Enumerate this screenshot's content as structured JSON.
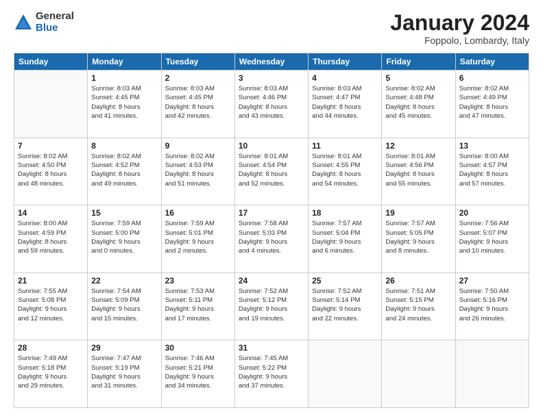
{
  "logo": {
    "general": "General",
    "blue": "Blue"
  },
  "header": {
    "month": "January 2024",
    "location": "Foppolo, Lombardy, Italy"
  },
  "days_of_week": [
    "Sunday",
    "Monday",
    "Tuesday",
    "Wednesday",
    "Thursday",
    "Friday",
    "Saturday"
  ],
  "weeks": [
    [
      {
        "day": "",
        "info": ""
      },
      {
        "day": "1",
        "info": "Sunrise: 8:03 AM\nSunset: 4:45 PM\nDaylight: 8 hours\nand 41 minutes."
      },
      {
        "day": "2",
        "info": "Sunrise: 8:03 AM\nSunset: 4:45 PM\nDaylight: 8 hours\nand 42 minutes."
      },
      {
        "day": "3",
        "info": "Sunrise: 8:03 AM\nSunset: 4:46 PM\nDaylight: 8 hours\nand 43 minutes."
      },
      {
        "day": "4",
        "info": "Sunrise: 8:03 AM\nSunset: 4:47 PM\nDaylight: 8 hours\nand 44 minutes."
      },
      {
        "day": "5",
        "info": "Sunrise: 8:02 AM\nSunset: 4:48 PM\nDaylight: 8 hours\nand 45 minutes."
      },
      {
        "day": "6",
        "info": "Sunrise: 8:02 AM\nSunset: 4:49 PM\nDaylight: 8 hours\nand 47 minutes."
      }
    ],
    [
      {
        "day": "7",
        "info": "Sunrise: 8:02 AM\nSunset: 4:50 PM\nDaylight: 8 hours\nand 48 minutes."
      },
      {
        "day": "8",
        "info": "Sunrise: 8:02 AM\nSunset: 4:52 PM\nDaylight: 8 hours\nand 49 minutes."
      },
      {
        "day": "9",
        "info": "Sunrise: 8:02 AM\nSunset: 4:53 PM\nDaylight: 8 hours\nand 51 minutes."
      },
      {
        "day": "10",
        "info": "Sunrise: 8:01 AM\nSunset: 4:54 PM\nDaylight: 8 hours\nand 52 minutes."
      },
      {
        "day": "11",
        "info": "Sunrise: 8:01 AM\nSunset: 4:55 PM\nDaylight: 8 hours\nand 54 minutes."
      },
      {
        "day": "12",
        "info": "Sunrise: 8:01 AM\nSunset: 4:56 PM\nDaylight: 8 hours\nand 55 minutes."
      },
      {
        "day": "13",
        "info": "Sunrise: 8:00 AM\nSunset: 4:57 PM\nDaylight: 8 hours\nand 57 minutes."
      }
    ],
    [
      {
        "day": "14",
        "info": "Sunrise: 8:00 AM\nSunset: 4:59 PM\nDaylight: 8 hours\nand 59 minutes."
      },
      {
        "day": "15",
        "info": "Sunrise: 7:59 AM\nSunset: 5:00 PM\nDaylight: 9 hours\nand 0 minutes."
      },
      {
        "day": "16",
        "info": "Sunrise: 7:59 AM\nSunset: 5:01 PM\nDaylight: 9 hours\nand 2 minutes."
      },
      {
        "day": "17",
        "info": "Sunrise: 7:58 AM\nSunset: 5:03 PM\nDaylight: 9 hours\nand 4 minutes."
      },
      {
        "day": "18",
        "info": "Sunrise: 7:57 AM\nSunset: 5:04 PM\nDaylight: 9 hours\nand 6 minutes."
      },
      {
        "day": "19",
        "info": "Sunrise: 7:57 AM\nSunset: 5:05 PM\nDaylight: 9 hours\nand 8 minutes."
      },
      {
        "day": "20",
        "info": "Sunrise: 7:56 AM\nSunset: 5:07 PM\nDaylight: 9 hours\nand 10 minutes."
      }
    ],
    [
      {
        "day": "21",
        "info": "Sunrise: 7:55 AM\nSunset: 5:08 PM\nDaylight: 9 hours\nand 12 minutes."
      },
      {
        "day": "22",
        "info": "Sunrise: 7:54 AM\nSunset: 5:09 PM\nDaylight: 9 hours\nand 15 minutes."
      },
      {
        "day": "23",
        "info": "Sunrise: 7:53 AM\nSunset: 5:11 PM\nDaylight: 9 hours\nand 17 minutes."
      },
      {
        "day": "24",
        "info": "Sunrise: 7:52 AM\nSunset: 5:12 PM\nDaylight: 9 hours\nand 19 minutes."
      },
      {
        "day": "25",
        "info": "Sunrise: 7:52 AM\nSunset: 5:14 PM\nDaylight: 9 hours\nand 22 minutes."
      },
      {
        "day": "26",
        "info": "Sunrise: 7:51 AM\nSunset: 5:15 PM\nDaylight: 9 hours\nand 24 minutes."
      },
      {
        "day": "27",
        "info": "Sunrise: 7:50 AM\nSunset: 5:16 PM\nDaylight: 9 hours\nand 26 minutes."
      }
    ],
    [
      {
        "day": "28",
        "info": "Sunrise: 7:49 AM\nSunset: 5:18 PM\nDaylight: 9 hours\nand 29 minutes."
      },
      {
        "day": "29",
        "info": "Sunrise: 7:47 AM\nSunset: 5:19 PM\nDaylight: 9 hours\nand 31 minutes."
      },
      {
        "day": "30",
        "info": "Sunrise: 7:46 AM\nSunset: 5:21 PM\nDaylight: 9 hours\nand 34 minutes."
      },
      {
        "day": "31",
        "info": "Sunrise: 7:45 AM\nSunset: 5:22 PM\nDaylight: 9 hours\nand 37 minutes."
      },
      {
        "day": "",
        "info": ""
      },
      {
        "day": "",
        "info": ""
      },
      {
        "day": "",
        "info": ""
      }
    ]
  ]
}
